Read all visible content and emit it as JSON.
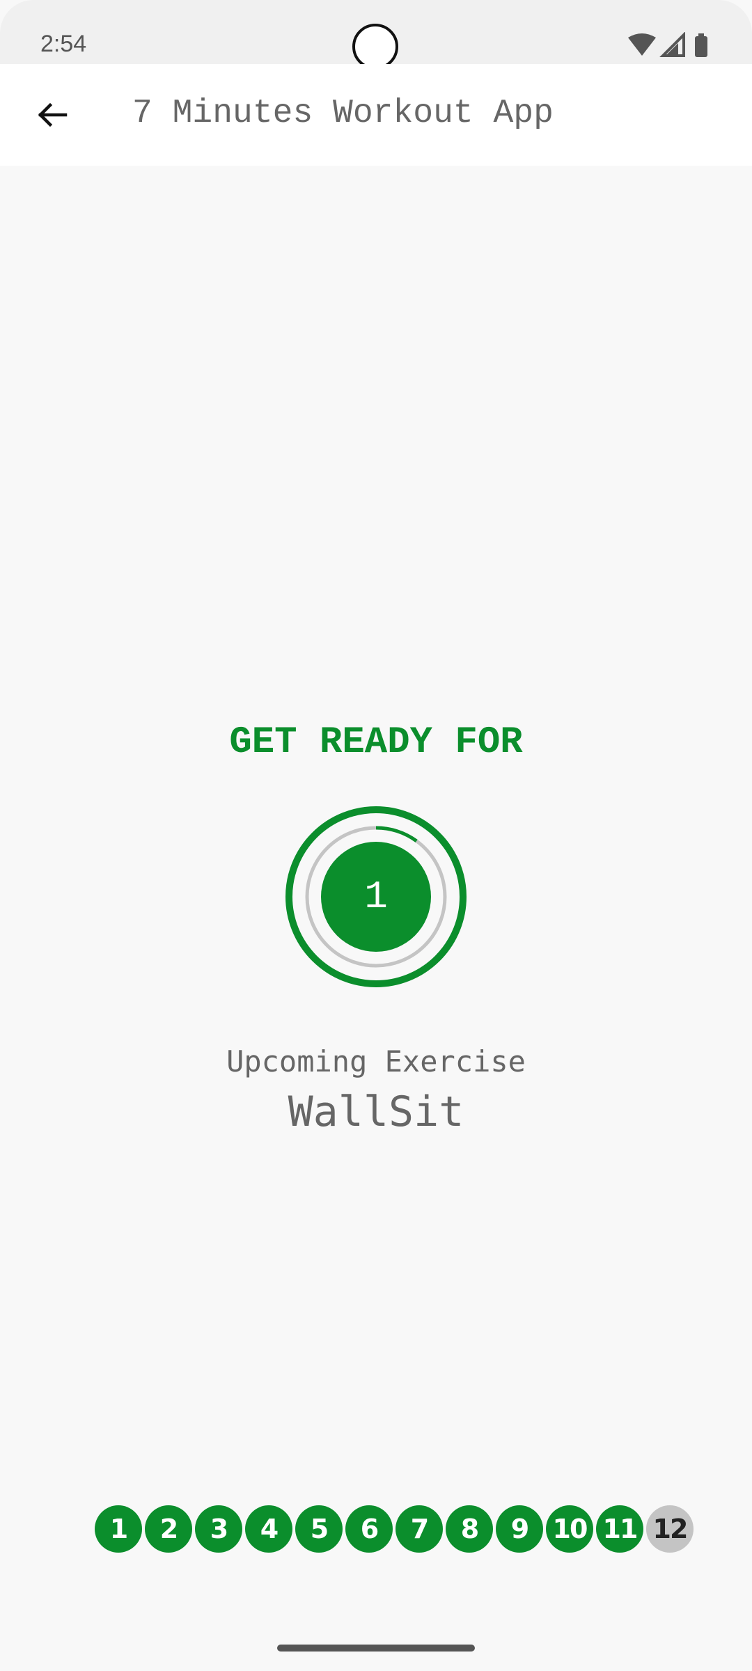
{
  "status_bar": {
    "time": "2:54"
  },
  "app_bar": {
    "title": "7 Minutes Workout App",
    "back_icon": "arrow-back-icon"
  },
  "main": {
    "heading": "GET READY FOR",
    "timer_value": "1",
    "timer_progress": 0.1,
    "upcoming_label": "Upcoming Exercise",
    "exercise_name": "WallSit"
  },
  "progress": {
    "steps": [
      "1",
      "2",
      "3",
      "4",
      "5",
      "6",
      "7",
      "8",
      "9",
      "10",
      "11",
      "12"
    ],
    "completed_count": 11
  },
  "colors": {
    "accent": "#0b8e2c",
    "pending": "#c4c4c4"
  }
}
